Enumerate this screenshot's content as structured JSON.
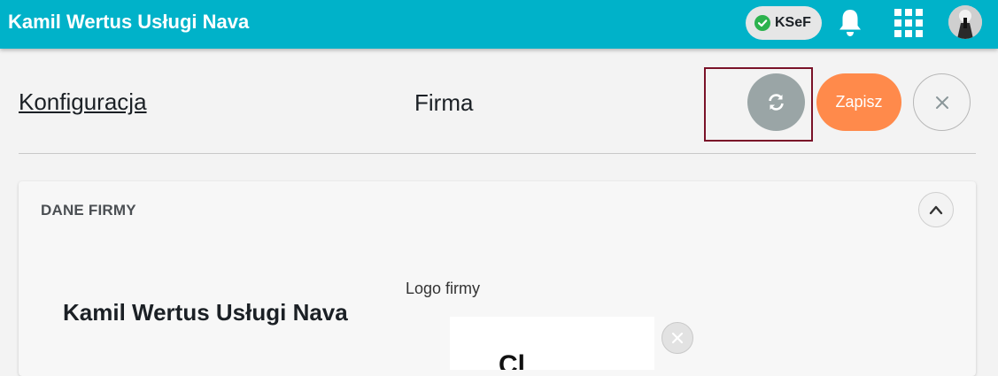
{
  "header": {
    "app_title": "Kamil Wertus Usługi Nava",
    "ksef_label": "KSeF",
    "icons": [
      "check-circle-icon",
      "bell-icon",
      "apps-grid-icon",
      "avatar"
    ]
  },
  "page": {
    "breadcrumb_link": "Konfiguracja",
    "title": "Firma",
    "actions": {
      "refresh_icon": "refresh-icon",
      "save_label": "Zapisz",
      "close_icon": "close-icon"
    }
  },
  "section": {
    "title": "DANE FIRMY",
    "collapse_icon": "chevron-up-icon",
    "company_name": "Kamil Wertus Usługi Nava",
    "logo_label": "Logo firmy",
    "logo_partial_text": "Cl",
    "remove_logo_icon": "close-icon"
  },
  "colors": {
    "topbar": "#00b2c9",
    "save_button": "#ff8a4b",
    "refresh_button": "#9aa5a6",
    "ksef_status": "#2cb24d",
    "highlight": "#7a1228"
  }
}
